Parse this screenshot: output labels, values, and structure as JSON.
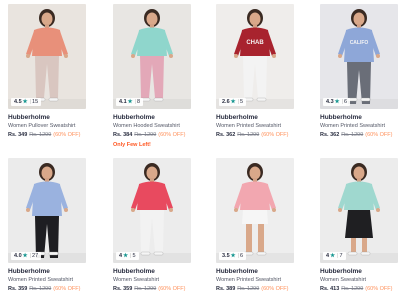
{
  "products": [
    {
      "brand": "Hubberholme",
      "desc": "Women Pullover Sweatshirt",
      "price": "Rs. 349",
      "mrp": "Rs. 1299",
      "off": "(60% OFF)",
      "rating": "4.5",
      "count": "15",
      "note": "",
      "bg": "#e9e4df",
      "top": "#e8907a",
      "bottom": "#d9c6c0"
    },
    {
      "brand": "Hubberholme",
      "desc": "Women Hooded Sweatshirt",
      "price": "Rs. 384",
      "mrp": "Rs. 1299",
      "off": "(60% OFF)",
      "rating": "4.1",
      "count": "8",
      "note": "Only Few Left!",
      "bg": "#e8e6e3",
      "top": "#8fd6cc",
      "bottom": "#e3a8b8"
    },
    {
      "brand": "Hubberholme",
      "desc": "Women Printed Sweatshirt",
      "price": "Rs. 362",
      "mrp": "Rs. 1299",
      "off": "(60% OFF)",
      "rating": "2.6",
      "count": "5",
      "note": "",
      "bg": "#efedeb",
      "top": "#a8232e",
      "bottom": "#f3f3f3"
    },
    {
      "brand": "Hubberholme",
      "desc": "Women Printed Sweatshirt",
      "price": "Rs. 362",
      "mrp": "Rs. 1299",
      "off": "(60% OFF)",
      "rating": "4.3",
      "count": "6",
      "note": "",
      "bg": "#e6e6ea",
      "top": "#8ea7d8",
      "bottom": "#6a6e78"
    },
    {
      "brand": "Hubberholme",
      "desc": "Women Printed Sweatshirt",
      "price": "Rs. 359",
      "mrp": "Rs. 1299",
      "off": "(60% OFF)",
      "rating": "4.0",
      "count": "27",
      "note": "",
      "bg": "#ebebeb",
      "top": "#9ab2df",
      "bottom": "#1e1e22"
    },
    {
      "brand": "Hubberholme",
      "desc": "Women Sweatshirt",
      "price": "Rs. 359",
      "mrp": "Rs. 1299",
      "off": "(60% OFF)",
      "rating": "4",
      "count": "5",
      "note": "",
      "bg": "#ececec",
      "top": "#e84a5f",
      "bottom": "#f2f2f2"
    },
    {
      "brand": "Hubberholme",
      "desc": "Women Printed Sweatshirt",
      "price": "Rs. 389",
      "mrp": "Rs. 1299",
      "off": "(60% OFF)",
      "rating": "3.5",
      "count": "6",
      "note": "",
      "bg": "#eeeeee",
      "top": "#f2a7b0",
      "bottom": "#f6f6f6"
    },
    {
      "brand": "Hubberholme",
      "desc": "Women Sweatshirt",
      "price": "Rs. 413",
      "mrp": "Rs. 1299",
      "off": "(60% OFF)",
      "rating": "4",
      "count": "7",
      "note": "",
      "bg": "#ececec",
      "top": "#9fd8cf",
      "bottom": "#1f1f22"
    }
  ]
}
